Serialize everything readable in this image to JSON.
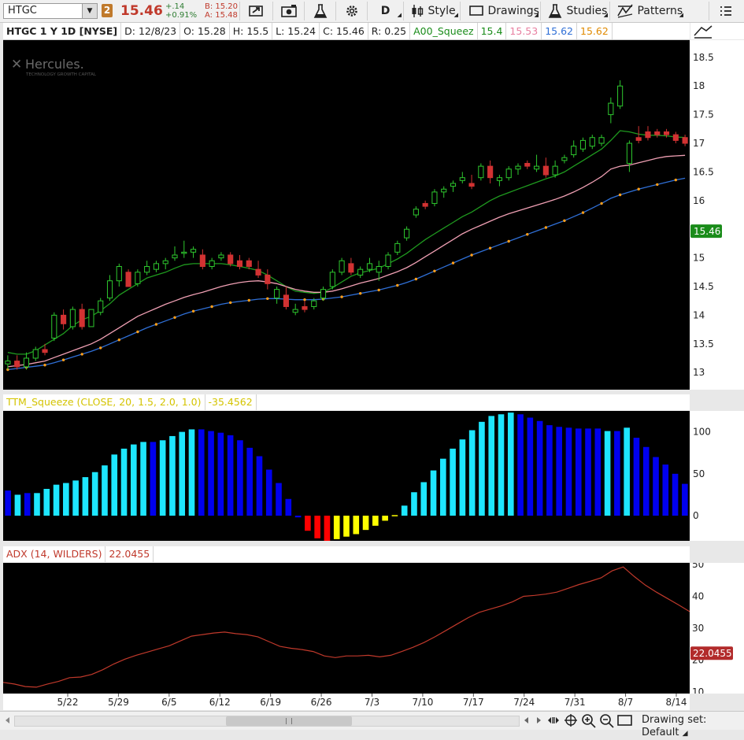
{
  "toolbar": {
    "symbol": "HTGC",
    "badge": "2",
    "last_price": "15.46",
    "change_abs": "+.14",
    "change_pct": "+0.91%",
    "bid": "B: 15.20",
    "ask": "A: 15.48",
    "period_label": "D",
    "style_label": "Style",
    "drawings_label": "Drawings",
    "studies_label": "Studies",
    "patterns_label": "Patterns"
  },
  "chart_header": {
    "title": "HTGC 1 Y 1D [NYSE]",
    "date": "D: 12/8/23",
    "open": "O: 15.28",
    "high": "H: 15.5",
    "low": "L: 15.24",
    "close": "C: 15.46",
    "range": "R: 0.25",
    "study_name": "A00_Squeez",
    "study_values": [
      "15.4",
      "15.53",
      "15.62",
      "15.62"
    ],
    "study_colors": [
      "#1a8c1a",
      "#e87fa0",
      "#2f6fd6",
      "#e08a00"
    ],
    "logo_name": "Hercules.",
    "logo_sub": "TECHNOLOGY GROWTH CAPITAL"
  },
  "price_axis": {
    "ticks": [
      "18.5",
      "18",
      "17.5",
      "17",
      "16.5",
      "16",
      "15.5",
      "15",
      "14.5",
      "14",
      "13.5",
      "13"
    ],
    "last_label": "15.46"
  },
  "squeeze_header": {
    "label": "TTM_Squeeze (CLOSE, 20, 1.5, 2.0, 1.0)",
    "value": "-35.4562"
  },
  "squeeze_axis": {
    "ticks": [
      "100",
      "50",
      "0"
    ]
  },
  "adx_header": {
    "label": "ADX (14, WILDERS)",
    "value": "22.0455"
  },
  "adx_axis": {
    "ticks": [
      "50",
      "40",
      "30",
      "20",
      "10"
    ],
    "last_label": "22.0455"
  },
  "time_axis": {
    "labels": [
      "5/22",
      "5/29",
      "6/5",
      "6/12",
      "6/19",
      "6/26",
      "7/3",
      "7/10",
      "7/17",
      "7/24",
      "7/31",
      "8/7",
      "8/14"
    ]
  },
  "bottom_bar": {
    "drawing_set": "Drawing set: Default"
  },
  "chart_data": [
    {
      "type": "candlestick",
      "axis_range": [
        12.7,
        18.8
      ],
      "candles": [
        [
          13.15,
          13.3,
          13.05,
          13.2
        ],
        [
          13.2,
          13.3,
          13.05,
          13.1
        ],
        [
          13.1,
          13.35,
          13.05,
          13.25
        ],
        [
          13.25,
          13.45,
          13.2,
          13.4
        ],
        [
          13.4,
          13.5,
          13.3,
          13.35
        ],
        [
          13.6,
          14.05,
          13.55,
          14.0
        ],
        [
          14.0,
          14.1,
          13.75,
          13.85
        ],
        [
          13.8,
          14.15,
          13.75,
          14.1
        ],
        [
          14.1,
          14.2,
          13.75,
          13.8
        ],
        [
          13.8,
          14.1,
          13.8,
          14.1
        ],
        [
          14.05,
          14.3,
          14.0,
          14.25
        ],
        [
          14.3,
          14.7,
          14.25,
          14.6
        ],
        [
          14.6,
          14.9,
          14.5,
          14.85
        ],
        [
          14.75,
          14.8,
          14.5,
          14.5
        ],
        [
          14.55,
          14.8,
          14.5,
          14.75
        ],
        [
          14.75,
          14.95,
          14.7,
          14.85
        ],
        [
          14.8,
          14.95,
          14.75,
          14.9
        ],
        [
          14.9,
          15.0,
          14.8,
          14.95
        ],
        [
          15.0,
          15.2,
          14.95,
          15.05
        ],
        [
          15.1,
          15.3,
          15.0,
          15.1
        ],
        [
          15.1,
          15.2,
          15.0,
          15.15
        ],
        [
          15.05,
          15.15,
          14.8,
          14.85
        ],
        [
          14.85,
          15.0,
          14.8,
          14.95
        ],
        [
          15.0,
          15.1,
          14.95,
          15.05
        ],
        [
          15.05,
          15.1,
          14.85,
          14.9
        ],
        [
          14.95,
          15.05,
          14.8,
          14.85
        ],
        [
          14.95,
          15.0,
          14.8,
          14.85
        ],
        [
          14.8,
          14.95,
          14.65,
          14.7
        ],
        [
          14.7,
          14.8,
          14.45,
          14.55
        ],
        [
          14.3,
          14.5,
          14.2,
          14.45
        ],
        [
          14.35,
          14.5,
          14.1,
          14.15
        ],
        [
          14.05,
          14.2,
          14.0,
          14.1
        ],
        [
          14.15,
          14.25,
          14.05,
          14.1
        ],
        [
          14.15,
          14.3,
          14.1,
          14.25
        ],
        [
          14.3,
          14.5,
          14.25,
          14.45
        ],
        [
          14.5,
          14.8,
          14.45,
          14.75
        ],
        [
          14.75,
          15.0,
          14.7,
          14.95
        ],
        [
          14.9,
          15.0,
          14.7,
          14.75
        ],
        [
          14.7,
          14.85,
          14.65,
          14.8
        ],
        [
          14.8,
          15.0,
          14.75,
          14.9
        ],
        [
          14.75,
          14.95,
          14.6,
          14.85
        ],
        [
          14.85,
          15.1,
          14.8,
          15.05
        ],
        [
          15.1,
          15.3,
          15.05,
          15.25
        ],
        [
          15.35,
          15.55,
          15.3,
          15.5
        ],
        [
          15.75,
          15.9,
          15.7,
          15.85
        ],
        [
          15.95,
          16.0,
          15.85,
          15.9
        ],
        [
          15.95,
          16.2,
          15.9,
          16.15
        ],
        [
          16.15,
          16.25,
          16.05,
          16.2
        ],
        [
          16.25,
          16.35,
          16.15,
          16.3
        ],
        [
          16.35,
          16.5,
          16.3,
          16.4
        ],
        [
          16.3,
          16.45,
          16.2,
          16.25
        ],
        [
          16.4,
          16.65,
          16.35,
          16.6
        ],
        [
          16.6,
          16.7,
          16.3,
          16.4
        ],
        [
          16.35,
          16.45,
          16.25,
          16.4
        ],
        [
          16.4,
          16.6,
          16.35,
          16.55
        ],
        [
          16.55,
          16.65,
          16.45,
          16.6
        ],
        [
          16.65,
          16.7,
          16.55,
          16.6
        ],
        [
          16.55,
          16.8,
          16.5,
          16.6
        ],
        [
          16.6,
          16.75,
          16.4,
          16.45
        ],
        [
          16.45,
          16.7,
          16.4,
          16.6
        ],
        [
          16.7,
          16.8,
          16.65,
          16.75
        ],
        [
          16.8,
          17.05,
          16.75,
          16.95
        ],
        [
          16.9,
          17.1,
          16.85,
          17.05
        ],
        [
          16.95,
          17.15,
          16.9,
          17.1
        ],
        [
          17.0,
          17.15,
          16.95,
          17.1
        ],
        [
          17.5,
          17.8,
          17.35,
          17.7
        ],
        [
          17.65,
          18.1,
          17.6,
          18.0
        ],
        [
          16.65,
          17.05,
          16.5,
          17.0
        ],
        [
          17.1,
          17.3,
          17.0,
          17.05
        ],
        [
          17.2,
          17.3,
          17.05,
          17.1
        ],
        [
          17.2,
          17.25,
          17.1,
          17.15
        ],
        [
          17.2,
          17.25,
          17.1,
          17.15
        ],
        [
          17.15,
          17.2,
          17.0,
          17.05
        ],
        [
          17.1,
          17.15,
          16.95,
          17.0
        ]
      ],
      "series": [
        {
          "name": "A00_Squeez line 1",
          "color": "#1f9a1f",
          "values": [
            13.35,
            13.32,
            13.32,
            13.38,
            13.48,
            13.58,
            13.68,
            13.82,
            13.92,
            13.98,
            14.08,
            14.2,
            14.35,
            14.45,
            14.55,
            14.65,
            14.7,
            14.75,
            14.82,
            14.88,
            14.9,
            14.9,
            14.9,
            14.9,
            14.88,
            14.85,
            14.82,
            14.78,
            14.7,
            14.6,
            14.5,
            14.42,
            14.4,
            14.38,
            14.4,
            14.48,
            14.58,
            14.68,
            14.74,
            14.78,
            14.82,
            14.9,
            14.98,
            15.08,
            15.2,
            15.32,
            15.42,
            15.52,
            15.62,
            15.72,
            15.8,
            15.9,
            16.0,
            16.08,
            16.14,
            16.2,
            16.26,
            16.32,
            16.38,
            16.43,
            16.5,
            16.6,
            16.7,
            16.8,
            16.9,
            17.05,
            17.22,
            17.2,
            17.16,
            17.14,
            17.14,
            17.13,
            17.11,
            17.1
          ]
        },
        {
          "name": "A00_Squeez line 2",
          "color": "#f0a0b4",
          "values": [
            13.1,
            13.12,
            13.14,
            13.17,
            13.2,
            13.26,
            13.32,
            13.38,
            13.44,
            13.5,
            13.58,
            13.68,
            13.78,
            13.88,
            13.98,
            14.05,
            14.12,
            14.19,
            14.25,
            14.31,
            14.36,
            14.4,
            14.45,
            14.5,
            14.54,
            14.57,
            14.59,
            14.6,
            14.58,
            14.55,
            14.5,
            14.45,
            14.42,
            14.4,
            14.4,
            14.42,
            14.46,
            14.51,
            14.56,
            14.6,
            14.64,
            14.7,
            14.76,
            14.83,
            14.92,
            15.02,
            15.12,
            15.22,
            15.32,
            15.42,
            15.5,
            15.57,
            15.64,
            15.71,
            15.77,
            15.82,
            15.87,
            15.92,
            15.97,
            16.02,
            16.08,
            16.15,
            16.23,
            16.32,
            16.42,
            16.55,
            16.6,
            16.62,
            16.66,
            16.7,
            16.74,
            16.77,
            16.78,
            16.79
          ]
        },
        {
          "name": "A00_Squeez line 3",
          "color": "#2f6fd6",
          "values": [
            13.05,
            13.07,
            13.09,
            13.11,
            13.13,
            13.17,
            13.22,
            13.27,
            13.32,
            13.37,
            13.43,
            13.5,
            13.57,
            13.64,
            13.71,
            13.78,
            13.84,
            13.9,
            13.96,
            14.02,
            14.07,
            14.11,
            14.15,
            14.19,
            14.22,
            14.24,
            14.26,
            14.28,
            14.29,
            14.29,
            14.28,
            14.27,
            14.27,
            14.27,
            14.28,
            14.3,
            14.32,
            14.35,
            14.38,
            14.41,
            14.44,
            14.48,
            14.52,
            14.57,
            14.63,
            14.7,
            14.77,
            14.84,
            14.91,
            14.98,
            15.05,
            15.11,
            15.17,
            15.23,
            15.29,
            15.35,
            15.41,
            15.47,
            15.53,
            15.59,
            15.65,
            15.72,
            15.79,
            15.87,
            15.95,
            16.04,
            16.1,
            16.15,
            16.2,
            16.24,
            16.28,
            16.32,
            16.36,
            16.39
          ]
        }
      ]
    },
    {
      "type": "bar",
      "title": "TTM_Squeeze (CLOSE, 20, 1.5, 2.0, 1.0)",
      "ylim": [
        -30,
        125
      ],
      "values": [
        30,
        25,
        27,
        27,
        32,
        37,
        39,
        42,
        46,
        52,
        60,
        73,
        80,
        85,
        88,
        88,
        90,
        95,
        100,
        103,
        103,
        101,
        99,
        96,
        90,
        81,
        71,
        55,
        39,
        20,
        -2,
        -18,
        -27,
        -30,
        -28,
        -25,
        -22,
        -17,
        -12,
        -6,
        -1,
        12,
        28,
        40,
        54,
        68,
        80,
        91,
        102,
        112,
        119,
        121,
        123,
        121,
        117,
        113,
        108,
        106,
        105,
        104,
        104,
        104,
        101,
        101,
        105,
        93,
        82,
        70,
        61,
        50,
        38
      ],
      "colors": [
        "#0000ee",
        "#1ee6ff",
        "#0000ee",
        "#1ee6ff",
        "#1ee6ff",
        "#1ee6ff",
        "#1ee6ff",
        "#1ee6ff",
        "#1ee6ff",
        "#1ee6ff",
        "#1ee6ff",
        "#1ee6ff",
        "#1ee6ff",
        "#1ee6ff",
        "#1ee6ff",
        "#0000ee",
        "#1ee6ff",
        "#1ee6ff",
        "#1ee6ff",
        "#1ee6ff",
        "#0000ee",
        "#0000ee",
        "#0000ee",
        "#0000ee",
        "#0000ee",
        "#0000ee",
        "#0000ee",
        "#0000ee",
        "#0000ee",
        "#0000ee",
        "#0000ee",
        "#ff0000",
        "#ff0000",
        "#ff0000",
        "#ffff00",
        "#ffff00",
        "#ffff00",
        "#ffff00",
        "#ffff00",
        "#ffff00",
        "#ffff00",
        "#1ee6ff",
        "#1ee6ff",
        "#1ee6ff",
        "#1ee6ff",
        "#1ee6ff",
        "#1ee6ff",
        "#1ee6ff",
        "#1ee6ff",
        "#1ee6ff",
        "#1ee6ff",
        "#1ee6ff",
        "#1ee6ff",
        "#0000ee",
        "#0000ee",
        "#0000ee",
        "#0000ee",
        "#0000ee",
        "#0000ee",
        "#0000ee",
        "#0000ee",
        "#0000ee",
        "#1ee6ff",
        "#0000ee",
        "#1ee6ff",
        "#0000ee",
        "#0000ee",
        "#0000ee",
        "#0000ee",
        "#0000ee",
        "#0000ee"
      ]
    },
    {
      "type": "line",
      "title": "ADX (14, WILDERS)",
      "ylim": [
        10,
        50
      ],
      "color": "#c0392b",
      "values": [
        13,
        12.5,
        11.7,
        11.5,
        12.5,
        13.3,
        14.5,
        14.7,
        15.5,
        17,
        18.8,
        20.3,
        21.5,
        22.5,
        23.5,
        24.5,
        26,
        27.5,
        28,
        28.5,
        28.8,
        28.3,
        28,
        27.3,
        25.8,
        24.3,
        23.7,
        23.3,
        22.7,
        21.3,
        20.8,
        21.3,
        21.3,
        21.5,
        21,
        21.5,
        22.7,
        24,
        25.5,
        27.3,
        29.3,
        31.3,
        33.3,
        35,
        36,
        37,
        38.3,
        40,
        40.3,
        40.7,
        41.3,
        42.5,
        43.7,
        44.7,
        45.8,
        48,
        49.2,
        46.2,
        43.5,
        41.3,
        39.3,
        37.3,
        35.2
      ]
    }
  ]
}
